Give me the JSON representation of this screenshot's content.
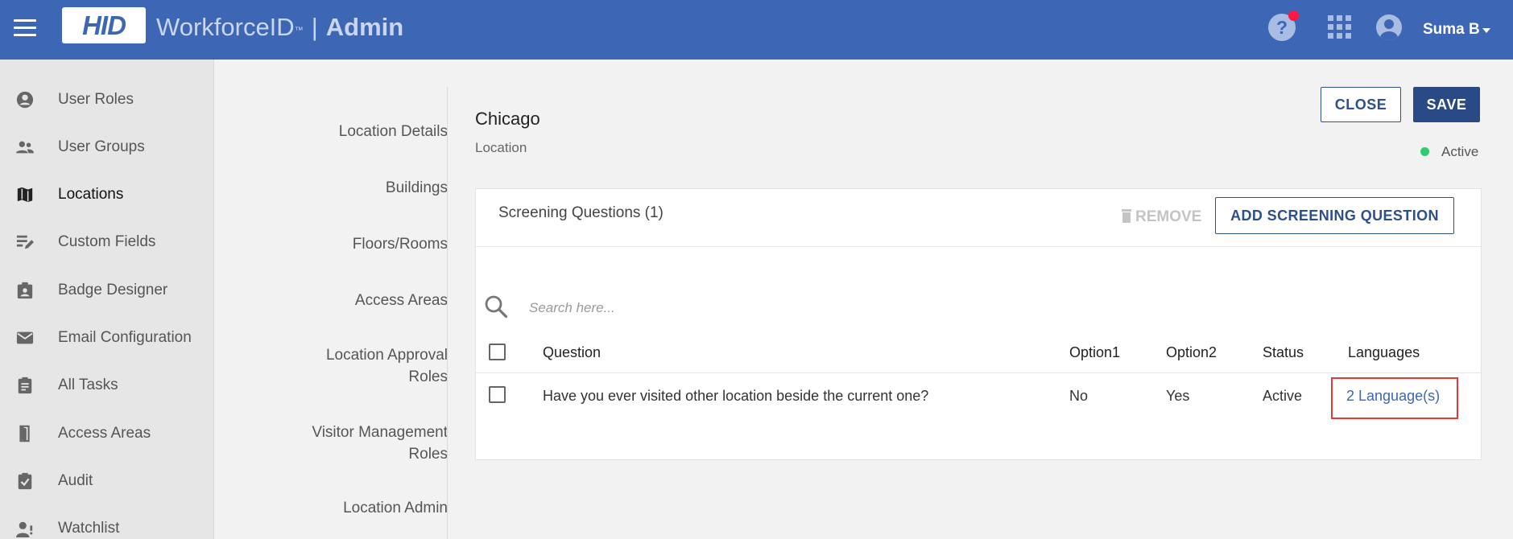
{
  "header": {
    "logo_text": "HID",
    "brand_name": "WorkforceID",
    "brand_tm": "™",
    "separator": "|",
    "section": "Admin",
    "help_glyph": "?",
    "user_name": "Suma B",
    "icons": [
      "menu-icon",
      "help-icon",
      "apps-grid-icon",
      "account-circle-icon",
      "caret-down-icon"
    ],
    "colors": {
      "bar": "#3d67b5",
      "notification": "#ff1744"
    }
  },
  "sidebar": {
    "items": [
      {
        "label": "User Roles",
        "icon": "account-circle-icon",
        "active": false
      },
      {
        "label": "User Groups",
        "icon": "people-icon",
        "active": false
      },
      {
        "label": "Locations",
        "icon": "map-icon",
        "active": true
      },
      {
        "label": "Custom Fields",
        "icon": "edit-note-icon",
        "active": false
      },
      {
        "label": "Badge Designer",
        "icon": "badge-icon",
        "active": false
      },
      {
        "label": "Email Configuration",
        "icon": "email-icon",
        "active": false
      },
      {
        "label": "All Tasks",
        "icon": "clipboard-icon",
        "active": false
      },
      {
        "label": "Access Areas",
        "icon": "door-icon",
        "active": false
      },
      {
        "label": "Audit",
        "icon": "audit-check-icon",
        "active": false
      },
      {
        "label": "Watchlist",
        "icon": "person-watch-icon",
        "active": false
      }
    ]
  },
  "subnav": {
    "items": [
      "Location Details",
      "Buildings",
      "Floors/Rooms",
      "Access Areas",
      "Location Approval Roles",
      "Visitor Management Roles",
      "Location Admin"
    ]
  },
  "main": {
    "title": "Chicago",
    "subtitle": "Location",
    "close_label": "CLOSE",
    "save_label": "SAVE",
    "status": "Active",
    "status_color": "#2ecc71"
  },
  "screening": {
    "title": "Screening Questions (1)",
    "remove_label": "REMOVE",
    "add_label": "ADD SCREENING QUESTION",
    "search_placeholder": "Search here...",
    "columns": [
      "Question",
      "Option1",
      "Option2",
      "Status",
      "Languages"
    ],
    "rows": [
      {
        "question": "Have you ever visited other location beside the current one?",
        "option1": "No",
        "option2": "Yes",
        "status": "Active",
        "languages": "2 Language(s)"
      }
    ],
    "highlight_color": "#e53935"
  }
}
